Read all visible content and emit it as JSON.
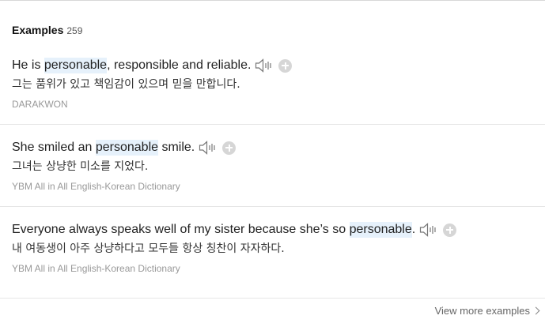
{
  "examples_header": {
    "title": "Examples",
    "count": "259"
  },
  "examples": [
    {
      "before": "He is ",
      "highlight": "personable",
      "after": ", responsible and reliable.",
      "translation": "그는 품위가 있고 책임감이 있으며 믿을 만합니다.",
      "source": "DARAKWON"
    },
    {
      "before": "She smiled an ",
      "highlight": "personable",
      "after": " smile.",
      "translation": "그녀는 상냥한 미소를 지었다.",
      "source": "YBM All in All English-Korean Dictionary"
    },
    {
      "before": "Everyone always speaks well of my sister because she’s so ",
      "highlight": "personable",
      "after": ".",
      "translation": "내 여동생이 아주 상냥하다고 모두들 항상 칭찬이 자자하다.",
      "source": "YBM All in All English-Korean Dictionary"
    }
  ],
  "footer": {
    "view_more": "View more examples"
  },
  "icons": {
    "sound": "speaker-icon",
    "add": "plus-icon",
    "more": "chevron-right-icon"
  },
  "colors": {
    "highlight": "#e6f1fb",
    "source_text": "#999999",
    "icon_gray": "#d6d6d6"
  }
}
